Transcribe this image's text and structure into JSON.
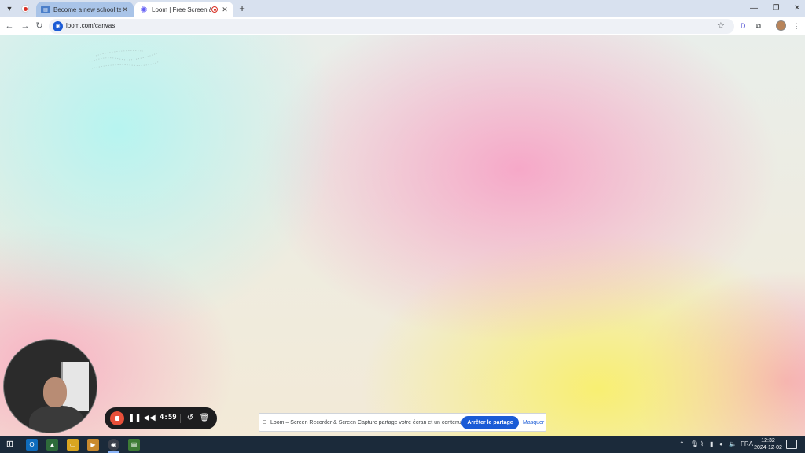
{
  "browser": {
    "tab_menu_icon": "chevron-down-icon",
    "tabs": [
      {
        "title": "Become a new school teacher",
        "favicon": "doc-icon",
        "close": "✕",
        "active": false
      },
      {
        "title": "Loom | Free Screen & Video",
        "favicon": "loom-icon",
        "close": "✕",
        "active": true
      }
    ],
    "new_tab": "+",
    "window_controls": {
      "minimize": "—",
      "maximize": "❐",
      "close": "✕"
    },
    "address": "loom.com/canvas",
    "extension_letter": "D"
  },
  "loom_bar": {
    "timer": "4:59",
    "stop_color": "#e8503a"
  },
  "share_notice": {
    "message": "Loom – Screen Recorder & Screen Capture partage votre écran et un contenu audio.",
    "stop_button": "Arrêter le partage",
    "hide_link": "Masquer"
  },
  "taskbar": {
    "language": "FRA",
    "time": "12:32",
    "date": "2024-12-02"
  },
  "colors": {
    "accent": "#1a5bd6",
    "canvas_cyan": "#b7f4f0",
    "canvas_pink": "#f6a8c8",
    "canvas_yellow": "#f8ef72"
  }
}
